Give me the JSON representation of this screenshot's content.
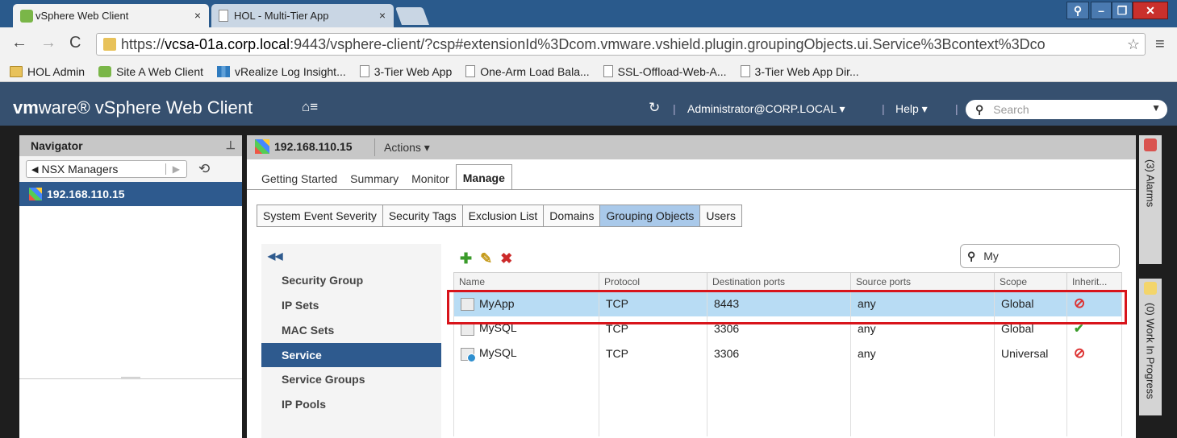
{
  "browser": {
    "tabs": [
      {
        "title": "vSphere Web Client",
        "close": "×"
      },
      {
        "title": "HOL - Multi-Tier App",
        "close": "×"
      }
    ],
    "url": {
      "scheme": "https://",
      "host": "vcsa-01a.corp.local",
      "rest": ":9443/vsphere-client/?csp#extensionId%3Dcom.vmware.vshield.plugin.groupingObjects.ui.Service%3Bcontext%3Dco"
    },
    "bookmarks": [
      {
        "label": "HOL Admin",
        "icon": "folder-icon"
      },
      {
        "label": "Site A Web Client",
        "icon": "vsphere-icon"
      },
      {
        "label": "vRealize Log Insight...",
        "icon": "log-insight-icon"
      },
      {
        "label": "3-Tier Web App",
        "icon": "page-icon"
      },
      {
        "label": "One-Arm Load Bala...",
        "icon": "page-icon"
      },
      {
        "label": "SSL-Offload-Web-A...",
        "icon": "page-icon"
      },
      {
        "label": "3-Tier Web App Dir...",
        "icon": "page-icon"
      }
    ]
  },
  "vsphere": {
    "logo_vm": "vm",
    "logo_rest": "ware® vSphere Web Client",
    "home": "⌂≡",
    "refresh": "↻",
    "user": "Administrator@CORP.LOCAL ▾",
    "help": "Help ▾",
    "search_placeholder": "Search"
  },
  "navigator": {
    "title": "Navigator",
    "breadcrumb": "NSX Managers",
    "selected": "192.168.110.15"
  },
  "object": {
    "title": "192.168.110.15",
    "actions": "Actions ▾"
  },
  "main_tabs": [
    "Getting Started",
    "Summary",
    "Monitor",
    "Manage"
  ],
  "sub_tabs": [
    "System Event Severity",
    "Security Tags",
    "Exclusion List",
    "Domains",
    "Grouping Objects",
    "Users"
  ],
  "left_list": [
    "Security Group",
    "IP Sets",
    "MAC Sets",
    "Service",
    "Service Groups",
    "IP Pools"
  ],
  "grid": {
    "filter_value": "My",
    "columns": [
      "Name",
      "Protocol",
      "Destination ports",
      "Source ports",
      "Scope",
      "Inherit..."
    ],
    "rows": [
      {
        "name": "MyApp",
        "protocol": "TCP",
        "dest": "8443",
        "source": "any",
        "scope": "Global",
        "inherit": "no"
      },
      {
        "name": "MySQL",
        "protocol": "TCP",
        "dest": "3306",
        "source": "any",
        "scope": "Global",
        "inherit": "yes"
      },
      {
        "name": "MySQL",
        "protocol": "TCP",
        "dest": "3306",
        "source": "any",
        "scope": "Universal",
        "inherit": "no"
      }
    ]
  },
  "rail": {
    "alarms": "(3)  Alarms",
    "work": "(0)  Work In Progress"
  },
  "colors": {
    "header": "#36506f",
    "selection": "#2e5a8e",
    "highlight_box": "#d8141b"
  }
}
